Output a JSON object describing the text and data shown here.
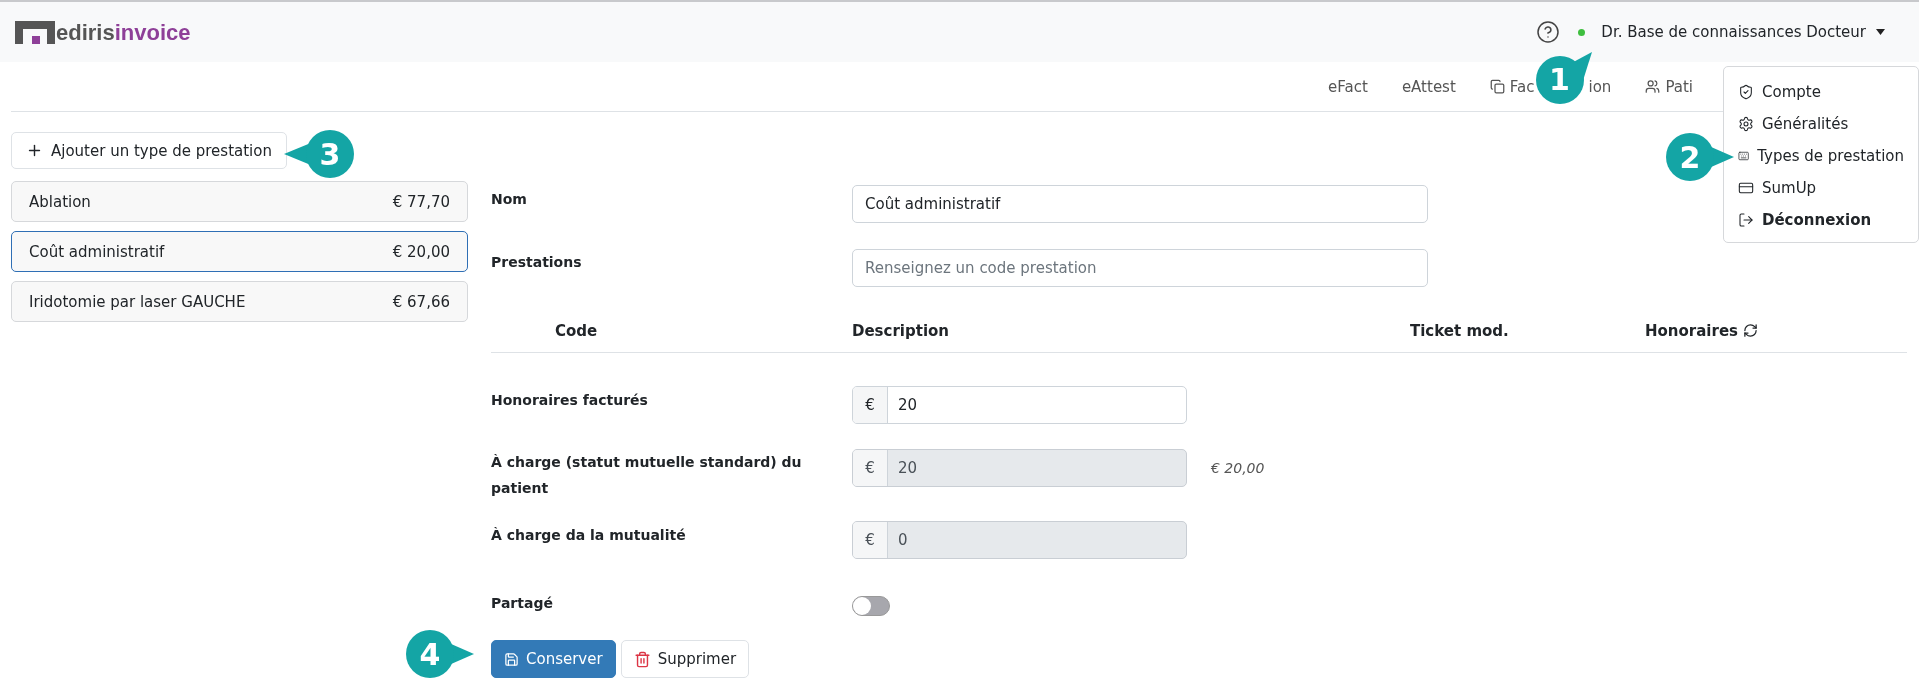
{
  "header": {
    "logo": {
      "part_1": "ediris",
      "part_2": "invoice"
    },
    "user": {
      "name": "Dr. Base de connaissances Docteur",
      "online": true
    }
  },
  "nav": [
    {
      "label": "eFact"
    },
    {
      "label": "eAttest"
    },
    {
      "label": "Fac",
      "label_end": "ion"
    },
    {
      "label": "Pati"
    }
  ],
  "user_menu": [
    {
      "label": "Compte",
      "bold": false
    },
    {
      "label": "Généralités",
      "bold": false
    },
    {
      "label": "Types de prestation",
      "bold": false
    },
    {
      "label": "SumUp",
      "bold": false
    },
    {
      "label": "Déconnexion",
      "bold": true
    }
  ],
  "add_button": "Ajouter un type de prestation",
  "service_types": [
    {
      "name": "Ablation",
      "price": "€ 77,70",
      "selected": false
    },
    {
      "name": "Coût administratif",
      "price": "€ 20,00",
      "selected": true
    },
    {
      "name": "Iridotomie par laser GAUCHE",
      "price": "€ 67,66",
      "selected": false
    }
  ],
  "form": {
    "name": {
      "label": "Nom",
      "value": "Coût administratif"
    },
    "services": {
      "label": "Prestations",
      "placeholder": "Renseignez un code prestation"
    },
    "table": {
      "columns": [
        "Code",
        "Description",
        "Ticket mod.",
        "Honoraires"
      ]
    },
    "amounts": [
      {
        "label": "Honoraires facturés",
        "currency": "€",
        "value": "20",
        "readonly": false
      },
      {
        "label": "À charge (statut mutuelle standard) du patient",
        "currency": "€",
        "value": "20",
        "readonly": true,
        "hint": "€ 20,00"
      },
      {
        "label": "À charge da la mutualité",
        "currency": "€",
        "value": "0",
        "readonly": true
      }
    ],
    "shared": {
      "label": "Partagé",
      "on": false
    },
    "buttons": [
      {
        "label": "Conserver",
        "kind": "primary"
      },
      {
        "label": "Supprimer",
        "kind": "danger"
      }
    ]
  },
  "callouts": [
    {
      "number": "1"
    },
    {
      "number": "2"
    },
    {
      "number": "3"
    },
    {
      "number": "4"
    }
  ]
}
